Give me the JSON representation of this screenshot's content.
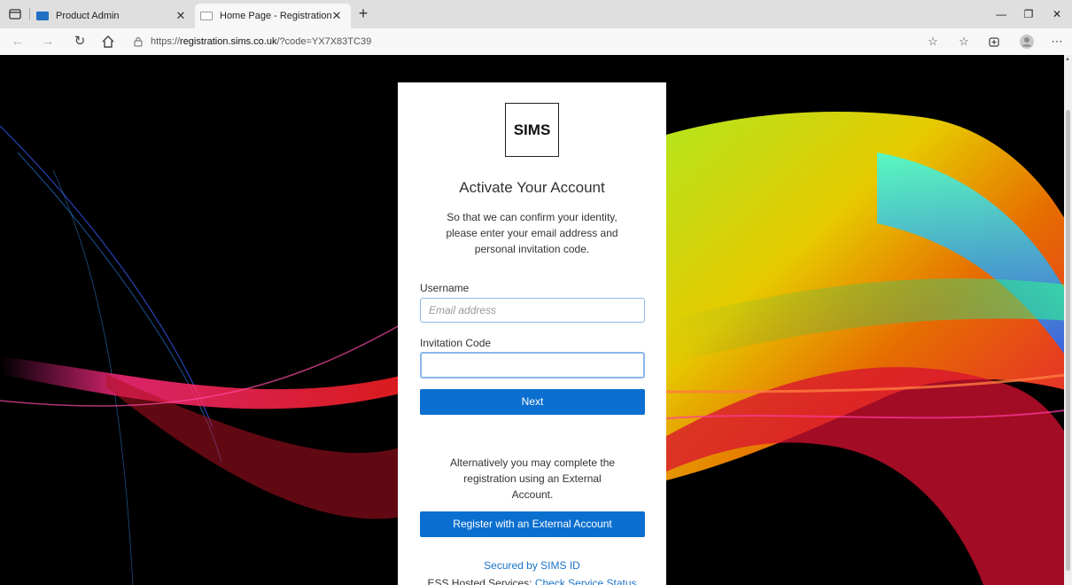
{
  "browser": {
    "tabs": [
      {
        "title": "Product Admin",
        "active": false,
        "favicon_color": "#1f6fc5"
      },
      {
        "title": "Home Page - Registration",
        "active": true,
        "favicon_color": "#888888"
      }
    ],
    "new_tab_symbol": "+",
    "address": {
      "scheme": "https://",
      "host": "registration.sims.co.uk",
      "path": "/?code=YX7X83TC39"
    }
  },
  "card": {
    "logo_text": "SIMS",
    "heading": "Activate Your Account",
    "intro": "So that we can confirm your identity, please enter your email address and personal invitation code.",
    "username_label": "Username",
    "username_placeholder": "Email address",
    "username_value": "",
    "invitation_label": "Invitation Code",
    "invitation_value": "",
    "next_button": "Next",
    "alternative_text": "Alternatively you may complete the registration using an External Account.",
    "external_button": "Register with an External Account",
    "secured_by": "Secured by SIMS ID",
    "ess_prefix": "ESS Hosted Services: ",
    "service_status_link": "Check Service Status"
  },
  "colors": {
    "primary_button": "#0b6fcf",
    "link": "#1a73c7",
    "page_background": "#000000"
  }
}
